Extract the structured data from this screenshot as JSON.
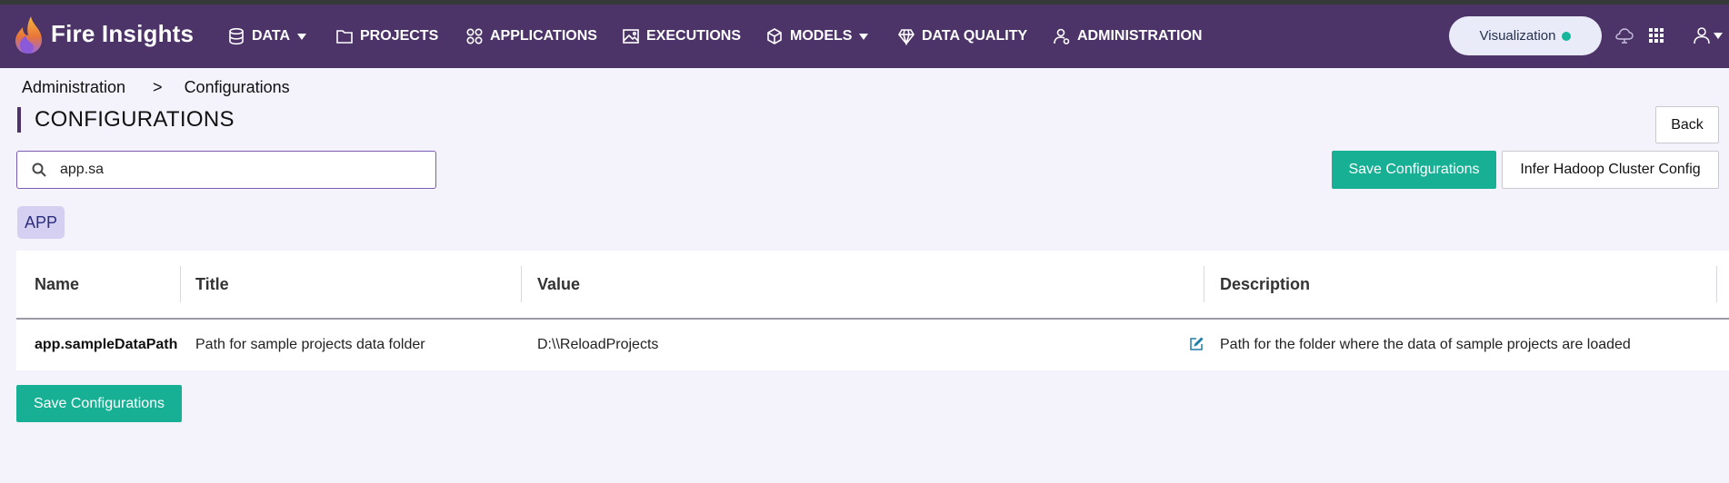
{
  "app": {
    "name": "Fire Insights"
  },
  "nav": {
    "items": [
      {
        "label": "DATA",
        "icon": "database-icon",
        "dropdown": true
      },
      {
        "label": "PROJECTS",
        "icon": "folder-icon",
        "dropdown": false
      },
      {
        "label": "APPLICATIONS",
        "icon": "apps-icon",
        "dropdown": false
      },
      {
        "label": "EXECUTIONS",
        "icon": "image-icon",
        "dropdown": false
      },
      {
        "label": "MODELS",
        "icon": "cube-icon",
        "dropdown": true
      },
      {
        "label": "DATA QUALITY",
        "icon": "diamond-icon",
        "dropdown": false
      },
      {
        "label": "ADMINISTRATION",
        "icon": "user-gear-icon",
        "dropdown": false
      }
    ],
    "visualization_label": "Visualization"
  },
  "breadcrumb": {
    "parent": "Administration",
    "separator": ">",
    "current": "Configurations"
  },
  "page": {
    "title": "CONFIGURATIONS"
  },
  "buttons": {
    "back": "Back",
    "save_top": "Save Configurations",
    "infer": "Infer Hadoop Cluster Config",
    "save_bottom": "Save Configurations"
  },
  "search": {
    "value": "app.sa"
  },
  "chip": {
    "label": "APP"
  },
  "table": {
    "columns": [
      "Name",
      "Title",
      "Value",
      "Description"
    ],
    "rows": [
      {
        "name": "app.sampleDataPath",
        "title": "Path for sample projects data folder",
        "value": "D:\\\\ReloadProjects",
        "description": "Path for the folder where the data of sample projects are loaded"
      }
    ]
  },
  "colors": {
    "navbar": "#4c3468",
    "accent_green": "#17b094",
    "chip_bg": "#d5d0f2",
    "page_bg": "#f4f3fc"
  }
}
